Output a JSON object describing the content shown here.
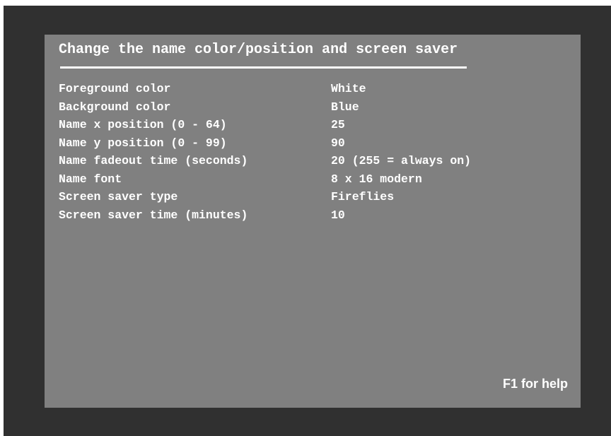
{
  "screen": {
    "title": "Change the name color/position and screen saver",
    "help_text": "F1 for help"
  },
  "settings": [
    {
      "label": "Foreground color",
      "value": "White"
    },
    {
      "label": "Background color",
      "value": "Blue"
    },
    {
      "label": "Name x position (0 - 64)",
      "value": "25"
    },
    {
      "label": "Name y position (0 - 99)",
      "value": "90"
    },
    {
      "label": "Name fadeout time (seconds)",
      "value": "20 (255 = always on)"
    },
    {
      "label": "Name font",
      "value": "8 x 16 modern"
    },
    {
      "label": "Screen saver type",
      "value": "Fireflies"
    },
    {
      "label": "Screen saver time (minutes)",
      "value": "10"
    }
  ],
  "colors": {
    "outer_background": "#303030",
    "panel_background": "#808080",
    "text": "#ffffff"
  }
}
